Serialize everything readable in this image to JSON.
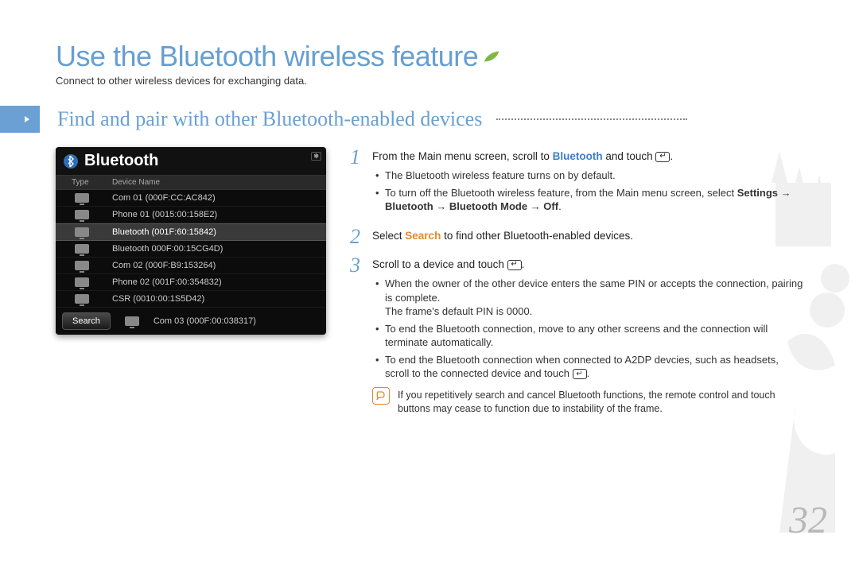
{
  "title": "Use the Bluetooth wireless feature",
  "subtitle": "Connect to other wireless devices for exchanging data.",
  "section_title": "Find and pair with other Bluetooth-enabled devices",
  "page_number": "32",
  "screenshot": {
    "title": "Bluetooth",
    "header_type": "Type",
    "header_name": "Device Name",
    "rows": [
      {
        "label": "Com 01 (000F:CC:AC842)",
        "selected": false
      },
      {
        "label": "Phone 01 (0015:00:158E2)",
        "selected": false
      },
      {
        "label": "Bluetooth (001F:60:15842)",
        "selected": true
      },
      {
        "label": "Bluetooth 000F:00:15CG4D)",
        "selected": false
      },
      {
        "label": "Com 02 (000F:B9:153264)",
        "selected": false
      },
      {
        "label": "Phone 02 (001F:00:354832)",
        "selected": false
      },
      {
        "label": "CSR (0010:00:1S5D42)",
        "selected": false
      }
    ],
    "search_label": "Search",
    "footer_extra": "Com 03 (000F:00:038317)"
  },
  "steps": {
    "s1_pre": "From the Main menu screen, scroll to ",
    "s1_kw": "Bluetooth",
    "s1_post": " and touch ",
    "s1_b1": "The Bluetooth wireless feature turns on by default.",
    "s1_b2a": "To turn off the Bluetooth wireless feature, from the Main menu screen, select ",
    "s1_b2b": "Settings → Bluetooth → Bluetooth Mode → Off",
    "s2_pre": "Select ",
    "s2_kw": "Search",
    "s2_post": " to find other Bluetooth-enabled devices.",
    "s3_pre": "Scroll to a device and touch ",
    "s3_b1": "When the owner of the other device enters the same PIN or accepts the connection, pairing is complete.",
    "s3_b1b": "The frame's default PIN is 0000.",
    "s3_b2": "To end the Bluetooth connection, move to any other screens and the connection will terminate automatically.",
    "s3_b3": "To end the Bluetooth connection when connected to A2DP devcies, such as headsets, scroll to the connected device and touch ",
    "note": "If you repetitively search and cancel Bluetooth functions, the remote control and touch buttons may cease to function due to instability of the frame."
  }
}
